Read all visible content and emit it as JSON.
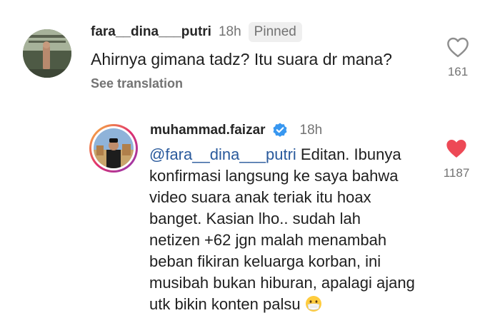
{
  "comment": {
    "username": "fara__dina___putri",
    "time": "18h",
    "badge": "Pinned",
    "text": "Ahirnya gimana tadz? Itu suara dr mana?",
    "see_translation": "See translation",
    "like_count": "161",
    "liked": false
  },
  "reply": {
    "username": "muhammad.faizar",
    "verified": true,
    "time": "18h",
    "mention": "@fara__dina___putri",
    "line1_rest": " Editan. Ibunya",
    "lines": [
      "konfirmasi langsung ke saya bahwa",
      "video suara anak teriak itu hoax",
      "banget. Kasian lho.. sudah lah",
      "netizen +62 jgn malah menambah",
      "beban fikiran keluarga korban, ini",
      "musibah bukan hiburan, apalagi ajang"
    ],
    "last_line": "utk bikin konten palsu",
    "emoji": "face-with-medical-mask-emoji",
    "like_count": "1187",
    "liked": true
  },
  "colors": {
    "heart_liked": "#ed4956",
    "mention": "#2a5a9c",
    "verified": "#3897f0",
    "muted": "#737373"
  }
}
